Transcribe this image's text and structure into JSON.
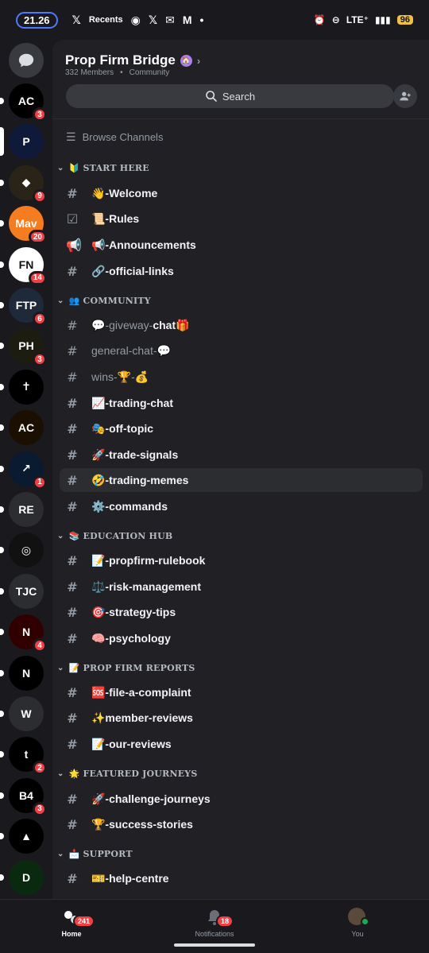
{
  "status_bar": {
    "time": "21.26",
    "recents_label": "Recents",
    "network": "LTE⁺",
    "battery": "96"
  },
  "server": {
    "name": "Prop Firm Bridge",
    "members": "332 Members",
    "type": "Community"
  },
  "search": {
    "label": "Search"
  },
  "browse": {
    "label": "Browse Channels"
  },
  "servers": [
    {
      "label": "",
      "badge": "3",
      "color": "#000000",
      "initials": "AC"
    },
    {
      "label": "",
      "badge": "",
      "color": "#0f1a3a",
      "initials": "P"
    },
    {
      "label": "",
      "badge": "9",
      "color": "#2a2418",
      "initials": "◆"
    },
    {
      "label": "",
      "badge": "20",
      "color": "#f57c1f",
      "initials": "Mav"
    },
    {
      "label": "",
      "badge": "14",
      "color": "#ffffff",
      "initials": "FN"
    },
    {
      "label": "",
      "badge": "6",
      "color": "#1e2a3a",
      "initials": "FTP"
    },
    {
      "label": "",
      "badge": "3",
      "color": "#1c1c10",
      "initials": "PH"
    },
    {
      "label": "",
      "badge": "",
      "color": "#000000",
      "initials": "✝"
    },
    {
      "label": "",
      "badge": "",
      "color": "#1a0f00",
      "initials": "AC"
    },
    {
      "label": "",
      "badge": "1",
      "color": "#0a1a30",
      "initials": "↗"
    },
    {
      "label": "RE",
      "badge": "",
      "color": "#2b2d31",
      "initials": "RE"
    },
    {
      "label": "",
      "badge": "",
      "color": "#111111",
      "initials": "◎"
    },
    {
      "label": "TJC",
      "badge": "",
      "color": "#2b2d31",
      "initials": "TJC"
    },
    {
      "label": "",
      "badge": "4",
      "color": "#300000",
      "initials": "N"
    },
    {
      "label": "",
      "badge": "",
      "color": "#000000",
      "initials": "N"
    },
    {
      "label": "W",
      "badge": "",
      "color": "#2b2d31",
      "initials": "W"
    },
    {
      "label": "",
      "badge": "2",
      "color": "#000000",
      "initials": "t"
    },
    {
      "label": "",
      "badge": "3",
      "color": "#000000",
      "initials": "B4"
    },
    {
      "label": "",
      "badge": "",
      "color": "#000000",
      "initials": "▲"
    },
    {
      "label": "",
      "badge": "",
      "color": "#0a2a10",
      "initials": "D"
    }
  ],
  "categories": {
    "start_here": "🔰 START HERE",
    "community": "👥 COMMUNITY",
    "education": "📚 EDUCATION HUB",
    "reports": "📝 PROP FIRM REPORTS",
    "journeys": "🌟 FEATURED JOURNEYS",
    "support": "📩 SUPPORT"
  },
  "channels": {
    "welcome": "👋-Welcome",
    "rules": "📜-Rules",
    "announcements": "📢-Announcements",
    "official_links": "🔗-official-links",
    "giveway_prefix": "💬-giveway-",
    "giveway_bold": "chat🎁",
    "general_chat": "general-chat-💬",
    "wins": "wins-🏆-💰",
    "trading_chat": "📈-trading-chat",
    "off_topic": "🎭-off-topic",
    "trade_signals": "🚀-trade-signals",
    "trading_memes": "🤣-trading-memes",
    "commands": "⚙️-commands",
    "propfirm_rulebook": "📝-propfirm-rulebook",
    "risk_management": "⚖️-risk-management",
    "strategy_tips": "🎯-strategy-tips",
    "psychology": "🧠-psychology",
    "file_complaint": "🆘-file-a-complaint",
    "member_reviews": "✨member-reviews",
    "our_reviews": "📝-our-reviews",
    "challenge_journeys": "🚀-challenge-journeys",
    "success_stories": "🏆-success-stories",
    "help_centre": "🎫-help-centre"
  },
  "tabs": {
    "home": "Home",
    "home_badge": "241",
    "notifications": "Notifications",
    "notifications_badge": "18",
    "you": "You"
  }
}
